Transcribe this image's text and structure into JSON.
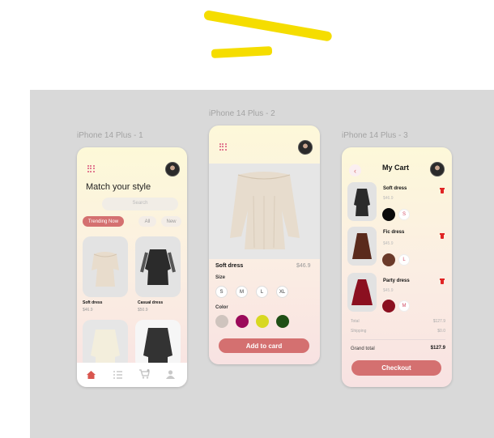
{
  "frames": {
    "f1_label": "iPhone 14 Plus - 1",
    "f2_label": "iPhone 14 Plus - 2",
    "f3_label": "iPhone 14 Plus - 3"
  },
  "home": {
    "title": "Match your style",
    "search_placeholder": "Search",
    "tabs": [
      "Trending Now",
      "All",
      "New"
    ],
    "products": [
      {
        "name": "Soft dress",
        "price": "$46.9"
      },
      {
        "name": "Casual dress",
        "price": "$50.9"
      }
    ],
    "nav": [
      "home-icon",
      "list-icon",
      "cart-icon",
      "profile-icon"
    ]
  },
  "detail": {
    "name": "Soft dress",
    "price": "$46.9",
    "size_label": "Size",
    "sizes": [
      "S",
      "M",
      "L",
      "XL"
    ],
    "color_label": "Color",
    "colors": [
      "#cfc4be",
      "#9b0a5a",
      "#d8d821",
      "#1f4f15"
    ],
    "cta": "Add to card"
  },
  "cart": {
    "title": "My Cart",
    "items": [
      {
        "name": "Soft dress",
        "price": "$46.9",
        "size": "S",
        "color": "#0a0a0a"
      },
      {
        "name": "Fic dress",
        "price": "$45.9",
        "size": "L",
        "color": "#6b3a2a"
      },
      {
        "name": "Party dress",
        "price": "$45.9",
        "size": "M",
        "color": "#8b1020"
      }
    ],
    "total_label": "Total",
    "total_value": "$127.9",
    "shipping_label": "Shipping",
    "shipping_value": "$0.0",
    "grand_label": "Grand total",
    "grand_value": "$127.9",
    "checkout": "Checkout"
  },
  "colors": {
    "accent": "#d47070",
    "canvas": "#d9d9d9",
    "highlight": "#f5dd00"
  }
}
